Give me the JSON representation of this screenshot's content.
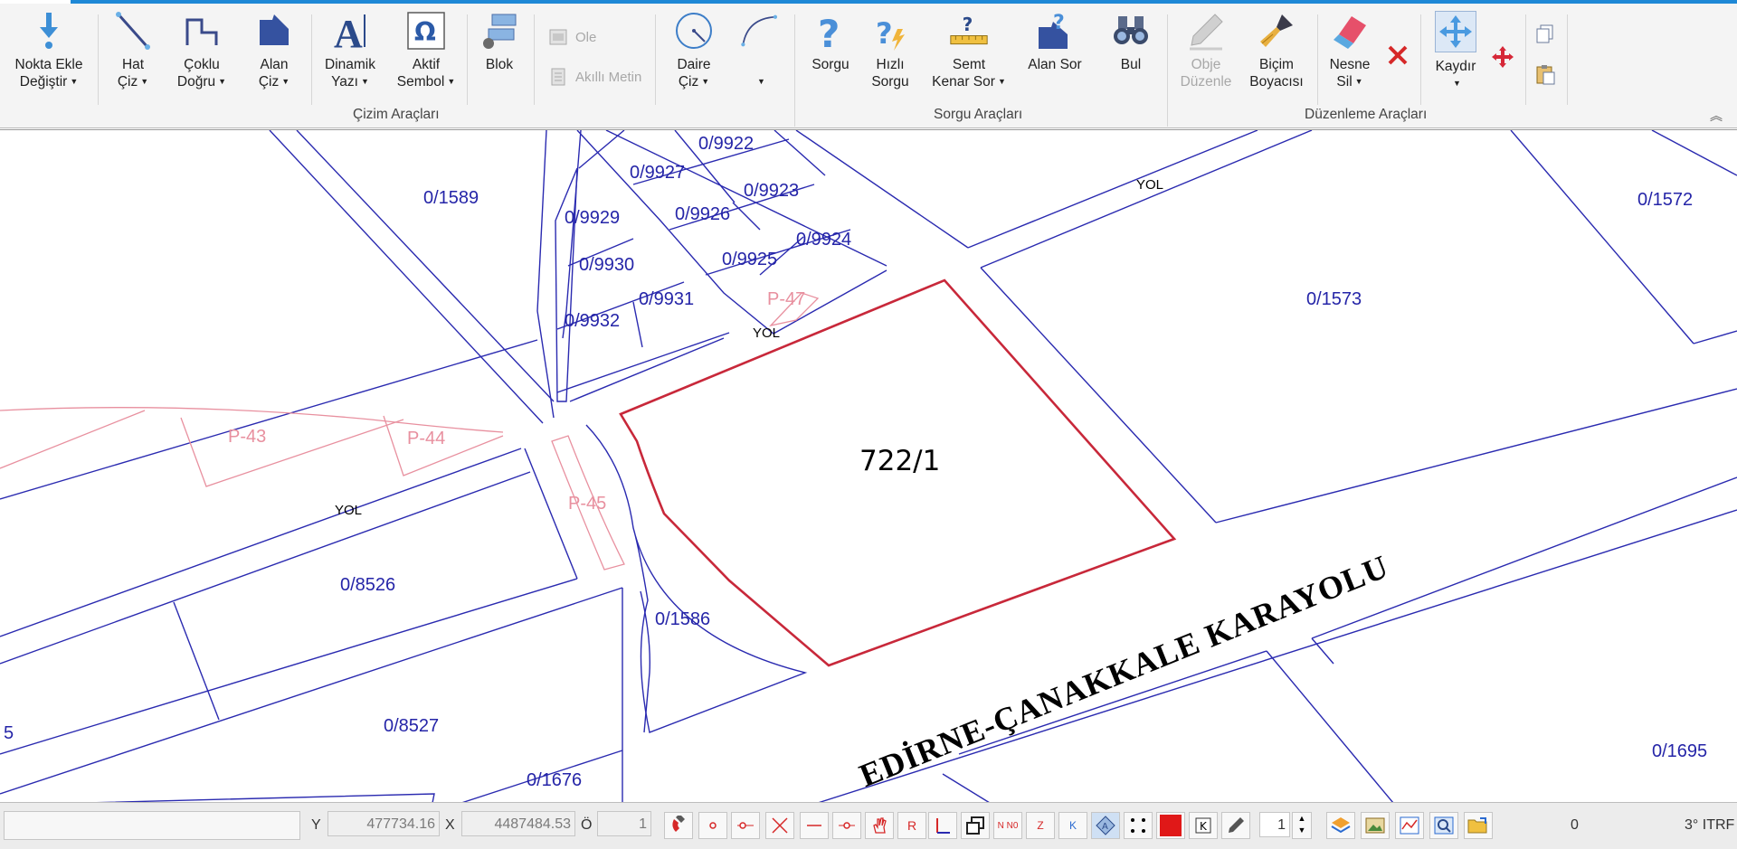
{
  "ribbon": {
    "buttons": [
      {
        "l1": "Nokta Ekle",
        "l2": "Değiştir",
        "dd": true
      },
      {
        "l1": "Hat",
        "l2": "Çiz",
        "dd": true
      },
      {
        "l1": "Çoklu",
        "l2": "Doğru",
        "dd": true
      },
      {
        "l1": "Alan",
        "l2": "Çiz",
        "dd": true
      },
      {
        "l1": "Dinamik",
        "l2": "Yazı",
        "dd": true
      },
      {
        "l1": "Aktif",
        "l2": "Sembol",
        "dd": true
      },
      {
        "l1": "Blok",
        "l2": ""
      },
      {
        "l1": "Daire",
        "l2": "Çiz",
        "dd": true
      },
      {
        "l1": "",
        "l2": "",
        "dd": true
      },
      {
        "l1": "Sorgu",
        "l2": ""
      },
      {
        "l1": "Hızlı",
        "l2": "Sorgu"
      },
      {
        "l1": "Semt",
        "l2": "Kenar Sor",
        "dd": true
      },
      {
        "l1": "Alan Sor",
        "l2": ""
      },
      {
        "l1": "Bul",
        "l2": ""
      },
      {
        "l1": "Obje",
        "l2": "Düzenle"
      },
      {
        "l1": "Biçim",
        "l2": "Boyacısı"
      },
      {
        "l1": "Nesne",
        "l2": "Sil",
        "dd": true
      },
      {
        "l1": "Kaydır",
        "l2": "",
        "dd": true
      }
    ],
    "small": {
      "ole": "Ole",
      "akilli_metin": "Akıllı Metin"
    },
    "groups": {
      "cizim": "Çizim Araçları",
      "sorgu": "Sorgu Araçları",
      "duzenleme": "Düzenleme Araçları"
    }
  },
  "map": {
    "parcels": [
      "0/9922",
      "0/9927",
      "0/9923",
      "0/1589",
      "0/9929",
      "0/9926",
      "0/9924",
      "0/9930",
      "0/9925",
      "0/9931",
      "0/9932",
      "0/1572",
      "0/1573",
      "0/8526",
      "0/1586",
      "0/8527",
      "0/1676",
      "0/1695",
      "5"
    ],
    "pink_labels": [
      "P-47",
      "P-43",
      "P-44",
      "P-45"
    ],
    "road_labels": [
      "YOL",
      "YOL",
      "YOL"
    ],
    "selected_parcel": "722/1",
    "highway_label": "EDİRNE-ÇANAKKALE KARAYOLU",
    "line_color": "#2a2ab0",
    "selection_color": "#c8283a",
    "pink_color": "#e8909f"
  },
  "status": {
    "y_label": "Y",
    "y_value": "477734.16",
    "x_label": "X",
    "x_value": "4487484.53",
    "o_label": "Ö",
    "o_value": "1",
    "step_value": "1",
    "icon_letter_r": "R",
    "icon_letter_no": "N N0",
    "icon_letter_z": "Z",
    "icon_letter_k": "K",
    "zero": "0",
    "projection": "3° ITRF"
  }
}
